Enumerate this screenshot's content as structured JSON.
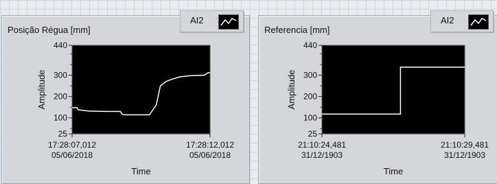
{
  "panels": [
    {
      "title": "Posição Régua [mm]",
      "legend": {
        "label": "AI2",
        "icon": "waveform-line-icon"
      },
      "y_axis_label": "Amplitude",
      "x_axis_label": "Time",
      "x_start": [
        "17:28:07,012",
        "05/06/2018"
      ],
      "x_end": [
        "17:28:12,012",
        "05/06/2018"
      ]
    },
    {
      "title": "Referencia [mm]",
      "legend": {
        "label": "AI2",
        "icon": "waveform-line-icon"
      },
      "y_axis_label": "Amplitude",
      "x_axis_label": "Time",
      "x_start": [
        "21:10:24,481",
        "31/12/1903"
      ],
      "x_end": [
        "21:10:29,481",
        "31/12/1903"
      ]
    }
  ],
  "chart_data": [
    {
      "type": "line",
      "ylabel": "Amplitude",
      "xlabel": "Time",
      "ylim": [
        25,
        440
      ],
      "yticks": [
        25,
        100,
        200,
        300,
        440
      ],
      "xlim": [
        0,
        5
      ],
      "x_tick_labels": [
        "17:28:07,012\n05/06/2018",
        "17:28:12,012\n05/06/2018"
      ],
      "grid": false,
      "line_color": "#ffffff",
      "background": "#000000",
      "series": [
        {
          "x": [
            0,
            0.18,
            0.22,
            0.6,
            1.25,
            1.75,
            1.82,
            2.0,
            2.1,
            2.2,
            2.4,
            2.5,
            2.8,
            3.05,
            3.2,
            3.4,
            3.6,
            3.9,
            4.3,
            4.8,
            4.9,
            5.0
          ],
          "y": [
            148,
            148,
            138,
            132,
            130,
            130,
            116,
            114,
            114,
            114,
            114,
            114,
            114,
            160,
            250,
            270,
            280,
            292,
            298,
            300,
            310,
            312
          ]
        }
      ]
    },
    {
      "type": "line",
      "ylabel": "Amplitude",
      "xlabel": "Time",
      "ylim": [
        25,
        440
      ],
      "yticks": [
        25,
        100,
        200,
        300,
        440
      ],
      "xlim": [
        0,
        5
      ],
      "x_tick_labels": [
        "21:10:24,481\n31/12/1903",
        "21:10:29,481\n31/12/1903"
      ],
      "grid": false,
      "line_color": "#ffffff",
      "background": "#000000",
      "series": [
        {
          "x": [
            0,
            2.75,
            2.75,
            5.0
          ],
          "y": [
            118,
            118,
            338,
            338
          ]
        }
      ]
    }
  ]
}
